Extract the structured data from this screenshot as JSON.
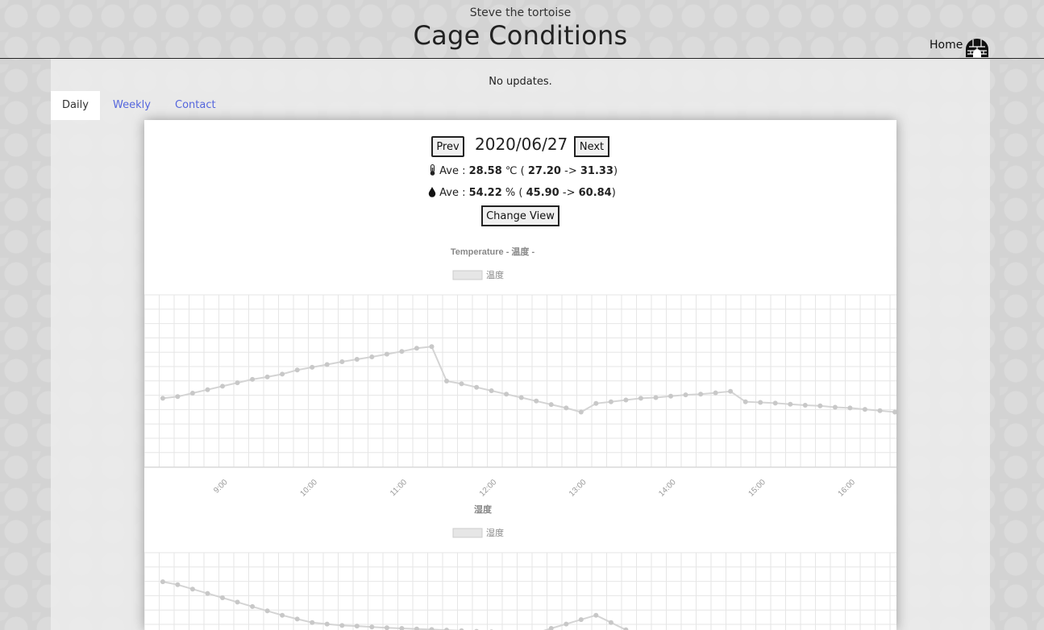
{
  "header": {
    "subtitle": "Steve the tortoise",
    "title": "Cage Conditions",
    "home_label": "Home"
  },
  "notice": "No updates.",
  "tabs": [
    {
      "label": "Daily",
      "active": true
    },
    {
      "label": "Weekly",
      "active": false
    },
    {
      "label": "Contact",
      "active": false
    }
  ],
  "nav": {
    "prev_label": "Prev",
    "next_label": "Next",
    "date": "2020/06/27",
    "change_view_label": "Change View"
  },
  "stats": {
    "temperature": {
      "ave_label": "Ave :",
      "ave": "28.58",
      "unit": "℃",
      "min": "27.20",
      "arrow": "->",
      "max": "31.33"
    },
    "humidity": {
      "ave_label": "Ave :",
      "ave": "54.22",
      "unit": "%",
      "min": "45.90",
      "arrow": "->",
      "max": "60.84"
    }
  },
  "icons": {
    "home": "igloo-icon",
    "temperature": "thermometer-icon",
    "humidity": "droplet-icon"
  },
  "colors": {
    "line": "#d4d4d4",
    "point": "#c8c8c8",
    "grid": "#e6e6e6",
    "tab_link": "#5566dd"
  },
  "chart_data": [
    {
      "type": "line",
      "title": "Temperature  - 温度 -",
      "series": [
        {
          "name": "温度",
          "x": [
            "8:20",
            "8:30",
            "8:40",
            "8:50",
            "9:00",
            "9:10",
            "9:20",
            "9:30",
            "9:40",
            "9:50",
            "10:00",
            "10:10",
            "10:20",
            "10:30",
            "10:40",
            "10:50",
            "11:00",
            "11:10",
            "11:20",
            "11:30",
            "11:40",
            "11:50",
            "12:00",
            "12:10",
            "12:20",
            "12:30",
            "12:40",
            "12:50",
            "13:00",
            "13:10",
            "13:20",
            "13:30",
            "13:40",
            "13:50",
            "14:00",
            "14:10",
            "14:20",
            "14:30",
            "14:40",
            "14:50",
            "15:00",
            "15:10",
            "15:20",
            "15:30",
            "15:40",
            "15:50",
            "16:00",
            "16:10",
            "16:20",
            "16:30"
          ],
          "values": [
            28.0,
            28.05,
            28.15,
            28.25,
            28.35,
            28.45,
            28.55,
            28.62,
            28.7,
            28.82,
            28.9,
            28.98,
            29.06,
            29.13,
            29.2,
            29.28,
            29.36,
            29.45,
            29.5,
            28.5,
            28.42,
            28.32,
            28.22,
            28.12,
            28.02,
            27.92,
            27.82,
            27.72,
            27.6,
            27.85,
            27.9,
            27.95,
            28.0,
            28.02,
            28.06,
            28.1,
            28.12,
            28.16,
            28.2,
            27.9,
            27.88,
            27.86,
            27.83,
            27.8,
            27.78,
            27.74,
            27.72,
            27.68,
            27.64,
            27.6
          ],
          "ylim": [
            26.0,
            31.0
          ]
        }
      ],
      "xticks": [
        "9:00",
        "10:00",
        "11:00",
        "12:00",
        "13:00",
        "14:00",
        "15:00",
        "16:00"
      ],
      "grid": true,
      "legend": "top"
    },
    {
      "type": "line",
      "title": "湿度",
      "series": [
        {
          "name": "湿度",
          "x": [
            "8:20",
            "8:30",
            "8:40",
            "8:50",
            "9:00",
            "9:10",
            "9:20",
            "9:30",
            "9:40",
            "9:50",
            "10:00",
            "10:10",
            "10:20",
            "10:30",
            "10:40",
            "10:50",
            "11:00",
            "11:10",
            "11:20",
            "11:30",
            "11:40",
            "11:50",
            "12:00",
            "12:10",
            "12:20",
            "12:30",
            "12:40",
            "12:50",
            "13:00",
            "13:10",
            "13:20",
            "13:30"
          ],
          "values": [
            60.0,
            59.9,
            59.75,
            59.6,
            59.45,
            59.3,
            59.15,
            59.0,
            58.85,
            58.72,
            58.6,
            58.55,
            58.5,
            58.48,
            58.45,
            58.42,
            58.4,
            58.38,
            58.36,
            58.34,
            58.32,
            58.3,
            58.28,
            58.26,
            58.25,
            58.24,
            58.4,
            58.55,
            58.7,
            58.85,
            58.6,
            58.35
          ],
          "ylim": [
            54.0,
            61.0
          ]
        }
      ],
      "grid": true,
      "legend": "top"
    }
  ]
}
